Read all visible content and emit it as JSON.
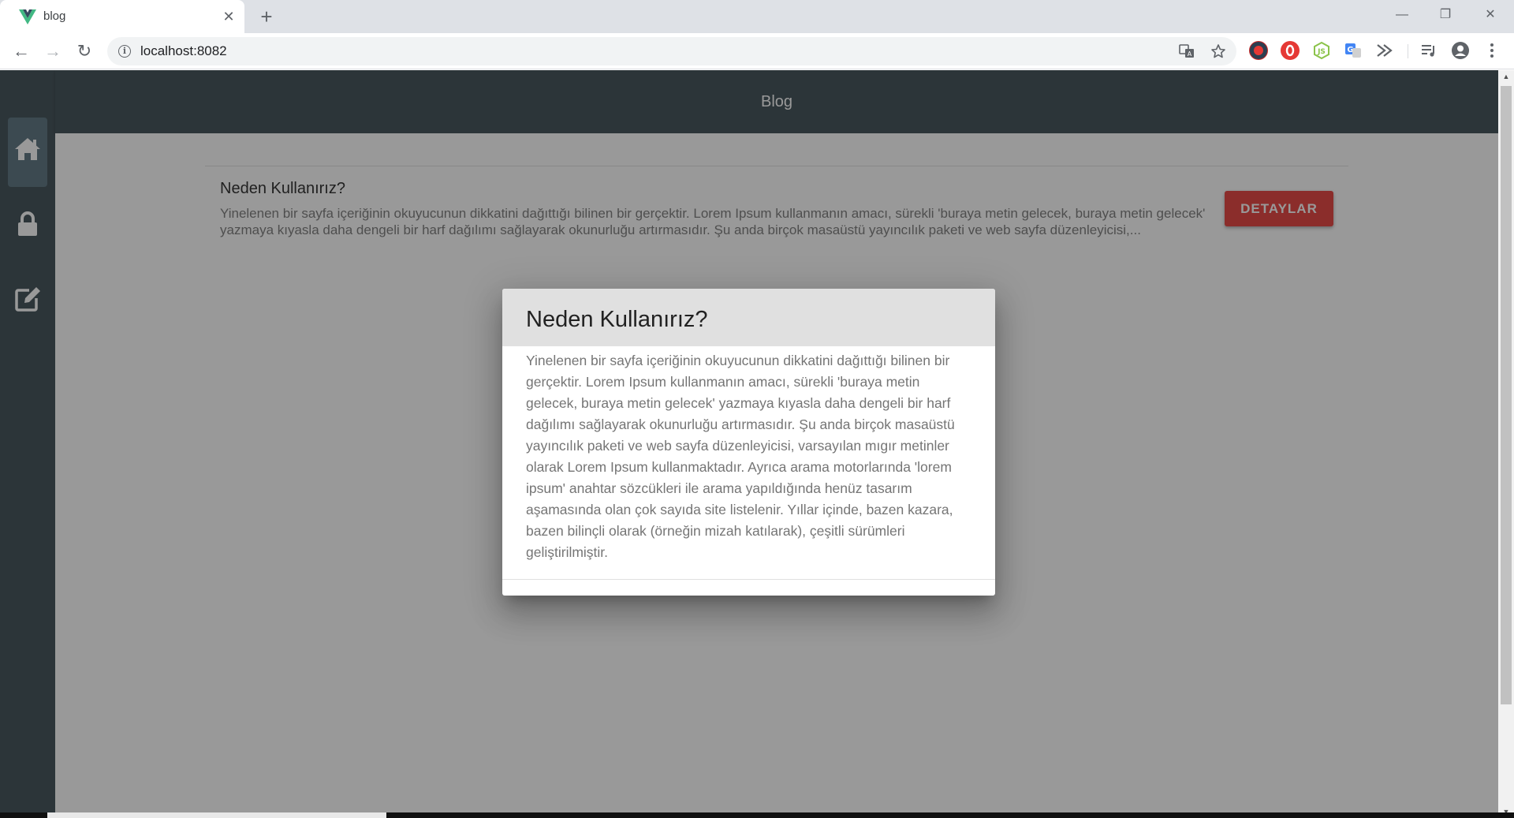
{
  "browser": {
    "tab": {
      "title": "blog",
      "favicon": "vue-logo-icon",
      "close_label": "✕"
    },
    "new_tab_label": "+",
    "window_controls": {
      "minimize": "—",
      "maximize": "❐",
      "close": "✕"
    },
    "nav": {
      "back": "←",
      "forward": "→",
      "reload": "↻"
    },
    "address": {
      "url": "localhost:8082",
      "info_icon": "i"
    },
    "omnibox_icons": [
      "translate-icon",
      "bookmark-star-icon"
    ],
    "extensions": [
      "extension-icon",
      "adblock-icon",
      "nodejs-icon",
      "translate-extension-icon",
      "send-icon",
      "media-control-icon",
      "profile-icon",
      "menu-icon"
    ]
  },
  "app": {
    "title": "Blog",
    "sidebar": [
      {
        "name": "home",
        "icon": "home-icon",
        "active": true
      },
      {
        "name": "lock",
        "icon": "lock-icon",
        "active": false
      },
      {
        "name": "edit",
        "icon": "edit-icon",
        "active": false
      }
    ],
    "post": {
      "title": "Neden Kullanırız?",
      "excerpt": "Yinelenen bir sayfa içeriğinin okuyucunun dikkatini dağıttığı bilinen bir gerçektir. Lorem Ipsum kullanmanın amacı, sürekli 'buraya metin gelecek, buraya metin gelecek' yazmaya kıyasla daha dengeli bir harf dağılımı sağlayarak okunurluğu artırmasıdır. Şu anda birçok masaüstü yayıncılık paketi ve web sayfa düzenleyicisi,...",
      "button_label": "DETAYLAR"
    }
  },
  "dialog": {
    "title": "Neden Kullanırız?",
    "body": "Yinelenen bir sayfa içeriğinin okuyucunun dikkatini dağıttığı bilinen bir gerçektir. Lorem Ipsum kullanmanın amacı, sürekli 'buraya metin gelecek, buraya metin gelecek' yazmaya kıyasla daha dengeli bir harf dağılımı sağlayarak okunurluğu artırmasıdır. Şu anda birçok masaüstü yayıncılık paketi ve web sayfa düzenleyicisi, varsayılan mıgır metinler olarak Lorem Ipsum kullanmaktadır. Ayrıca arama motorlarında 'lorem ipsum' anahtar sözcükleri ile arama yapıldığında henüz tasarım aşamasında olan çok sayıda site listelenir. Yıllar içinde, bazen kazara, bazen bilinçli olarak (örneğin mizah katılarak), çeşitli sürümleri geliştirilmiştir."
  },
  "colors": {
    "app_bar": "#37474f",
    "sidebar_active": "#546e7a",
    "button": "#e53935",
    "dialog_header": "#e0e0e0"
  }
}
